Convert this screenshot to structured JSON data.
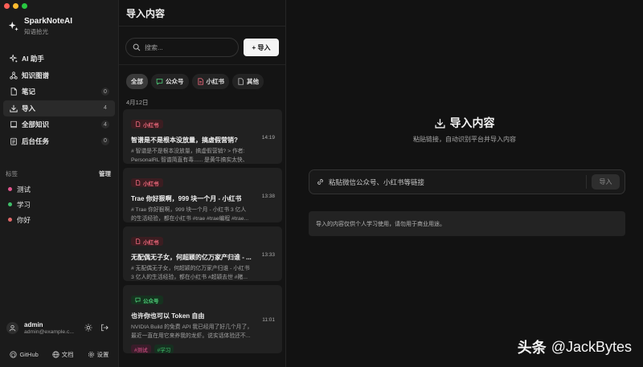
{
  "colors": {
    "traffic_red": "#ff5f57",
    "traffic_yellow": "#febc2e",
    "traffic_green": "#28c840",
    "xiaohongshu": "#f06a7d",
    "gongzhonghao": "#4fd07a"
  },
  "app": {
    "name": "SparkNoteAI",
    "tagline": "知语拾光"
  },
  "sidebar": {
    "nav": [
      {
        "label": "AI 助手",
        "icon": "sparkle-icon",
        "count": ""
      },
      {
        "label": "知识图谱",
        "icon": "graph-icon",
        "count": ""
      },
      {
        "label": "笔记",
        "icon": "note-icon",
        "count": "0"
      },
      {
        "label": "导入",
        "icon": "download-icon",
        "count": "4"
      },
      {
        "label": "全部知识",
        "icon": "book-icon",
        "count": "4"
      },
      {
        "label": "后台任务",
        "icon": "task-icon",
        "count": "0"
      }
    ],
    "tags_header": "标签",
    "tags_manage": "管理",
    "tags": [
      {
        "label": "测试",
        "color": "#e2568f"
      },
      {
        "label": "学习",
        "color": "#3fbf6a"
      },
      {
        "label": "你好",
        "color": "#e06868"
      }
    ],
    "user": {
      "name": "admin",
      "email": "admin@example.c..."
    },
    "footer": {
      "github": "GitHub",
      "docs": "文档",
      "settings": "设置"
    }
  },
  "middle": {
    "title": "导入内容",
    "search_placeholder": "搜索...",
    "import_button": "+ 导入",
    "filters": [
      {
        "label": "全部",
        "icon": ""
      },
      {
        "label": "公众号",
        "icon": "chat-icon"
      },
      {
        "label": "小红书",
        "icon": "xiaohongshu-icon"
      },
      {
        "label": "其他",
        "icon": "file-icon"
      }
    ],
    "date_group": "4月12日",
    "cards": [
      {
        "source": "小红书",
        "title": "智谱是不是根本没放量，搞虚假营销?",
        "body1": "# 智谱是不是根本没放量，搞虚假营销? > 作者:",
        "body2": "PersonalRL 智谱简直有毒...... 是黄牛搞实太快、",
        "time": "14:19",
        "tags": []
      },
      {
        "source": "小红书",
        "title": "Trae 你好狠啊，999 块一个月 - 小红书",
        "body1": "# Trae 你好狠啊，999 块一个月 - 小红书 3 亿人",
        "body2": "的生活经验，都在小红书 #trae #trae编程 #trae...",
        "time": "13:38",
        "tags": []
      },
      {
        "source": "小红书",
        "title": "无配偶无子女，何超颖的亿万家产归谁 - ...",
        "body1": "# 无配偶无子女，何超颖的亿万家产归谁 - 小红书",
        "body2": "3 亿人的生活经验，都在小红书 #超颖去世 #赌...",
        "time": "13:33",
        "tags": []
      },
      {
        "source": "公众号",
        "title": "也许你也可以 Token 自由",
        "body1": "NVIDIA Build 的免费 API 我已经用了好几个月了，",
        "body2": "最近一直在用它来养我的龙虾。说实话体验还不...",
        "time": "11:01",
        "tags": [
          {
            "label": "#测试",
            "color": "#e2568f",
            "bg": "#3a1c2a"
          },
          {
            "label": "#学习",
            "color": "#3fbf6a",
            "bg": "#163020"
          }
        ]
      }
    ]
  },
  "main": {
    "title": "导入内容",
    "subtitle": "粘贴链接，自动识别平台并导入内容",
    "link_placeholder": "粘贴微信公众号、小红书等链接",
    "submit": "导入",
    "notice": "导入的内容仅供个人学习使用，请勿用于商业用途。"
  },
  "watermark": {
    "cn": "头条",
    "handle": "@JackBytes"
  }
}
